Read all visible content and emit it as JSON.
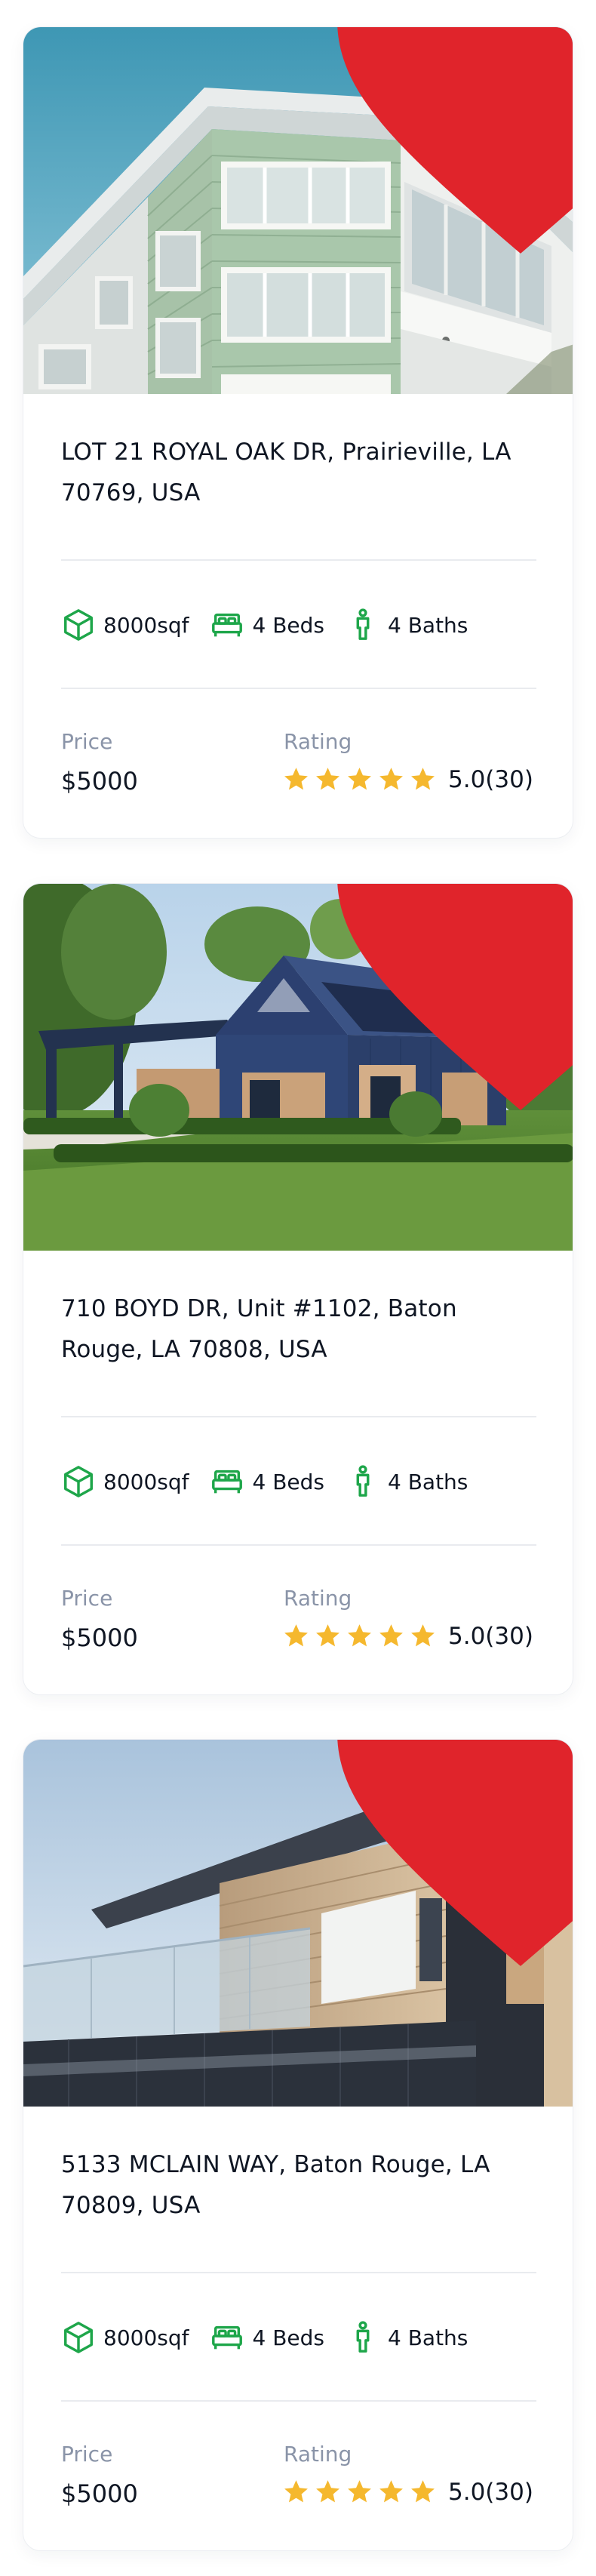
{
  "colors": {
    "accent_green": "#1ea64a",
    "heart_red": "#e0242b",
    "star_gold": "#f5b82e",
    "label_gray": "#8a94a8",
    "divider": "#e9ebef"
  },
  "icons": {
    "favorite": "heart-icon",
    "area": "cube-icon",
    "beds": "bed-icon",
    "baths": "person-icon",
    "rating": "star-icon"
  },
  "listings": [
    {
      "address": "LOT 21 ROYAL OAK DR, Prairieville, LA 70769, USA",
      "area": "8000sqf",
      "beds": "4 Beds",
      "baths": "4 Baths",
      "price_label": "Price",
      "price": "$5000",
      "rating_label": "Rating",
      "rating": "5.0(30)",
      "stars": 5
    },
    {
      "address": "710 BOYD DR, Unit #1102, Baton Rouge, LA 70808, USA",
      "area": "8000sqf",
      "beds": "4 Beds",
      "baths": "4 Baths",
      "price_label": "Price",
      "price": "$5000",
      "rating_label": "Rating",
      "rating": "5.0(30)",
      "stars": 5
    },
    {
      "address": "5133 MCLAIN WAY, Baton Rouge, LA 70809, USA",
      "area": "8000sqf",
      "beds": "4 Beds",
      "baths": "4 Baths",
      "price_label": "Price",
      "price": "$5000",
      "rating_label": "Rating",
      "rating": "5.0(30)",
      "stars": 5
    }
  ]
}
